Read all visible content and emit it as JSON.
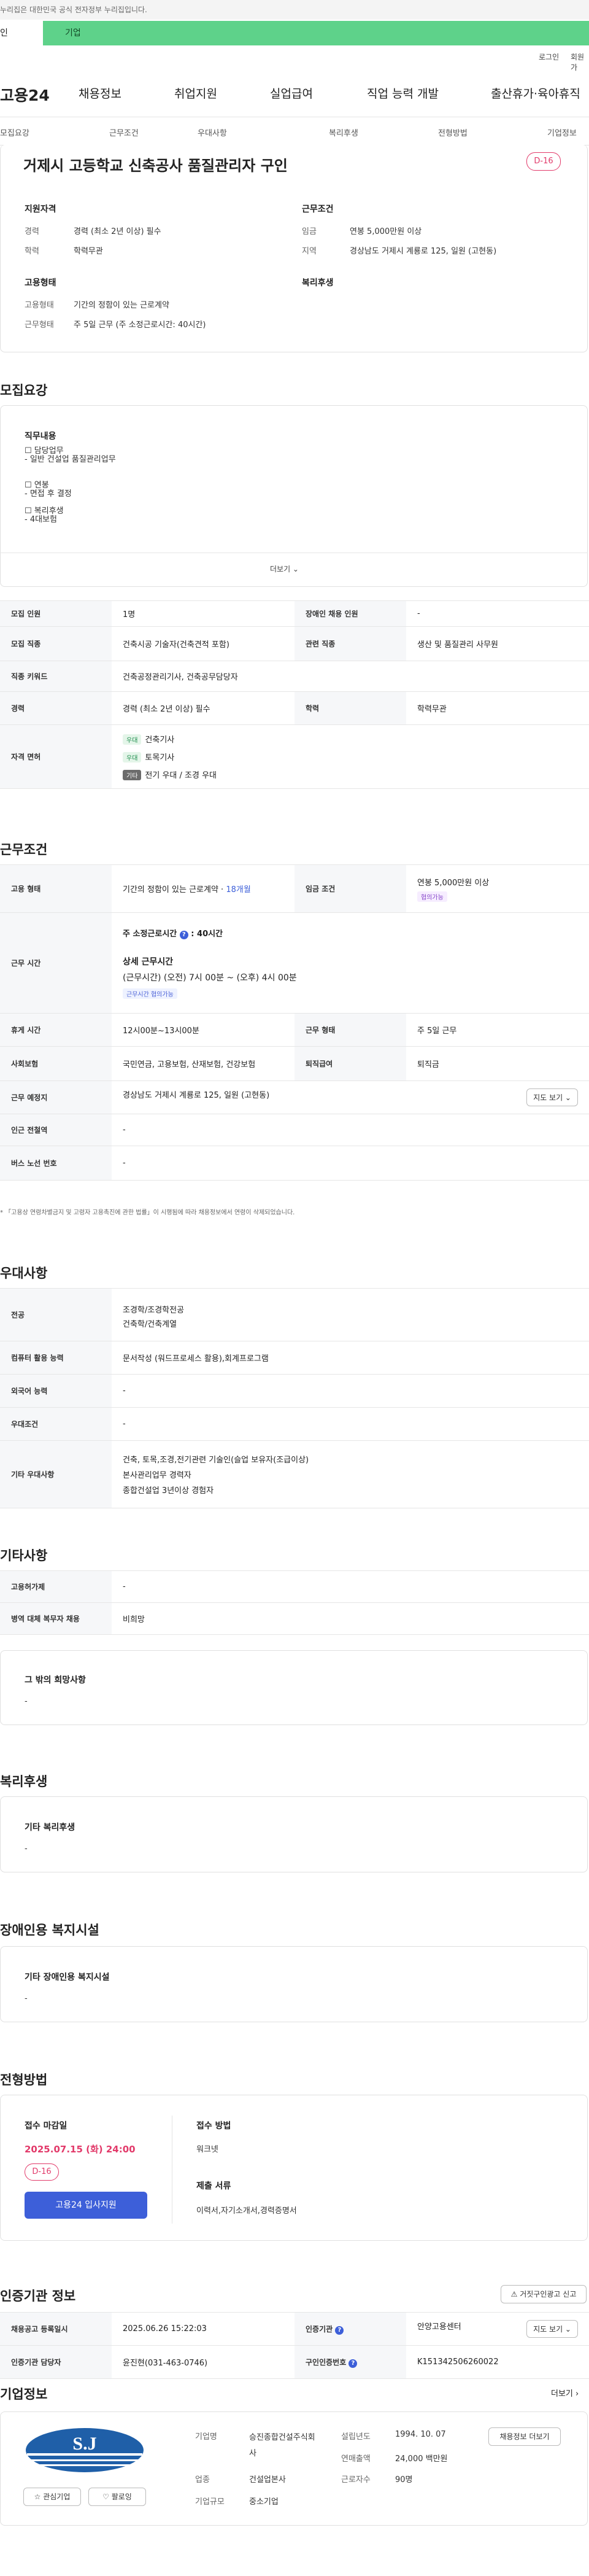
{
  "gov_notice": "누리집은 대한민국 공식 전자정부 누리집입니다.",
  "user_tabs": {
    "person": "인",
    "company": "기업"
  },
  "util": {
    "login": "로그인",
    "join": "회원가"
  },
  "logo": "고용24",
  "nav": [
    "채용정보",
    "취업지원",
    "실업급여",
    "직업 능력 개발",
    "출산휴가·육아휴직"
  ],
  "subnav": [
    "모집요강",
    "근무조건",
    "우대사항",
    "복리후생",
    "전형방법",
    "기업정보"
  ],
  "job": {
    "title": "거제시 고등학교 신축공사 품질관리자 구인",
    "dday": "D-16"
  },
  "summary": {
    "qual": {
      "head": "지원자격",
      "career_k": "경력",
      "career_v": "경력 (최소 2년 이상) 필수",
      "edu_k": "학력",
      "edu_v": "학력무관"
    },
    "cond": {
      "head": "근무조건",
      "wage_k": "임금",
      "wage_v": "연봉 5,000만원 이상",
      "loc_k": "지역",
      "loc_v": "경상남도 거제시 계룡로 125, 일원 (고현동)"
    },
    "emp": {
      "head": "고용형태",
      "type_k": "고용형태",
      "type_v": "기간의 정함이 있는 근로계약",
      "shift_k": "근무형태",
      "shift_v": "주 5일 근무 (주 소정근로시간: 40시간)"
    },
    "welfare": {
      "head": "복리후생"
    }
  },
  "recruit": {
    "title": "모집요강",
    "duty_head": "직무내용",
    "duty_lines": [
      "☐ 담당업무",
      "- 일반 건설업 품질관리업무",
      "",
      "☐ 연봉",
      "- 면접 후 결정",
      "",
      "☐ 복리후생",
      "- 4대보험"
    ],
    "more": "더보기 ⌄",
    "rows": [
      {
        "k": "모집 인원",
        "v": "1명",
        "k2": "장애인 채용 인원",
        "v2": "-"
      },
      {
        "k": "모집 직종",
        "v": "건축시공 기술자(건축견적 포함)",
        "k2": "관련 직종",
        "v2": "생산 및 품질관리 사무원"
      },
      {
        "k": "직종 키워드",
        "v": "건축공정관리기사, 건축공무담당자"
      },
      {
        "k": "경력",
        "v": "경력 (최소 2년 이상) 필수",
        "k2": "학력",
        "v2": "학력무관"
      }
    ],
    "license_k": "자격 면허",
    "licenses": [
      {
        "tag": "우대",
        "name": "건축기사"
      },
      {
        "tag": "우대",
        "name": "토목기사"
      },
      {
        "tag": "기타",
        "name": "전기 우대 / 조경 우대"
      }
    ]
  },
  "work": {
    "title": "근무조건",
    "emp_k": "고용 형태",
    "emp_v": "기간의 정함이 있는 근로계약 ·",
    "emp_period": "18개월",
    "wage_k": "임금 조건",
    "wage_v": "연봉 5,000만원 이상",
    "wage_chip": "협의가능",
    "hours_k": "근무 시간",
    "weekly": "주 소정근로시간",
    "weekly_v": "40시간",
    "detail_head": "상세 근무시간",
    "detail_v": "(근무시간) (오전) 7시 00분 ~ (오후) 4시 00분",
    "detail_chip": "근무시간 협의가능",
    "rest_k": "휴게 시간",
    "rest_v": "12시00분~13시00분",
    "shift_k": "근무 형태",
    "shift_v": "주 5일 근무",
    "ins_k": "사회보험",
    "ins_v": "국민연금, 고용보험, 산재보험, 건강보험",
    "ret_k": "퇴직급여",
    "ret_v": "퇴직금",
    "place_k": "근무 예정지",
    "place_v": "경상남도 거제시 계룡로 125, 일원 (고현동)",
    "map_btn": "지도 보기 ⌄",
    "subway_k": "인근 전철역",
    "subway_v": "-",
    "bus_k": "버스 노선 번호",
    "bus_v": "-",
    "note": "* 「고용상 연령차별금지 및 고령자 고용촉진에 관한 법률」이 시행됨에 따라 채용정보에서 연령이 삭제되었습니다."
  },
  "pref": {
    "title": "우대사항",
    "rows": [
      {
        "k": "전공",
        "v": [
          "조경학/조경학전공",
          "건축학/건축계열"
        ]
      },
      {
        "k": "컴퓨터 활용 능력",
        "v": [
          "문서작성 (워드프로세스 활용),회계프로그램"
        ]
      },
      {
        "k": "외국어 능력",
        "v": [
          "-"
        ]
      },
      {
        "k": "우대조건",
        "v": [
          "-"
        ]
      },
      {
        "k": "기타 우대사항",
        "v": [
          "건축, 토목,조경,전기관련 기술인(슬업 보유자(조급이상)",
          "본사관리업무 경력자",
          "종합건설업 3년이상 경험자"
        ]
      }
    ]
  },
  "etc": {
    "title": "기타사항",
    "hire_k": "고용허가제",
    "hire_v": "-",
    "mil_k": "병역 대체 복무자 채용",
    "mil_v": "비희망",
    "other_head": "그 밖의 희망사항",
    "other_v": "-"
  },
  "welfare": {
    "title": "복리후생",
    "head": "기타 복리후생",
    "v": "-"
  },
  "disab": {
    "title": "장애인용 복지시설",
    "head": "기타 장애인용 복지시설",
    "v": "-"
  },
  "select": {
    "title": "전형방법",
    "deadline_head": "접수 마감일",
    "deadline_v": "2025.07.15 (화) 24:00",
    "dday": "D-16",
    "apply_btn": "고용24 입사지원",
    "method_head": "접수 방법",
    "method_v": "워크넷",
    "doc_head": "제출 서류",
    "doc_v": "이력서,자기소개서,경력증명서"
  },
  "agency": {
    "title": "인증기관 정보",
    "report_btn": "거짓구인광고 신고",
    "reg_k": "채용공고 등록일시",
    "reg_v": "2025.06.26 15:22:03",
    "ag_k": "인증기관",
    "ag_v": "안양고용센터",
    "map_btn": "지도 보기 ⌄",
    "mgr_k": "인증기관 담당자",
    "mgr_v": "윤진현(031-463-0746)",
    "id_k": "구인인증번호",
    "id_v": "K151342506260022"
  },
  "company": {
    "title": "기업정보",
    "more": "더보기 ›",
    "logo_text": "S.J",
    "fav_btn": "☆ 관심기업",
    "follow_btn": "♡ 팔로잉",
    "name_k": "기업명",
    "name_v": "승진종합건설주식회사",
    "ind_k": "업종",
    "ind_v": "건설업본사",
    "size_k": "기업규모",
    "size_v": "중소기업",
    "est_k": "설립년도",
    "est_v": "1994. 10. 07",
    "sales_k": "연매출액",
    "sales_v": "24,000 백만원",
    "emp_k": "근로자수",
    "emp_v": "90명",
    "list_btn": "채용정보 더보기"
  }
}
